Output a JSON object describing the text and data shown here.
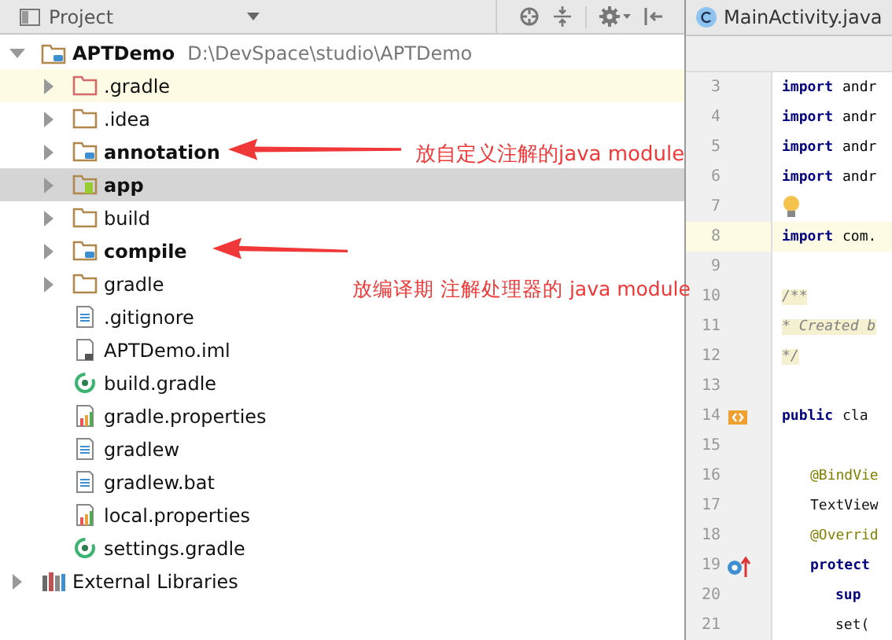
{
  "panel": {
    "title": "Project"
  },
  "tree": [
    {
      "name": "APTDemo",
      "path": "D:\\DevSpace\\studio\\APTDemo",
      "kind": "module",
      "bold": true,
      "expanded": true,
      "selected": false,
      "children": [
        {
          "name": ".gradle",
          "kind": "excluded-folder",
          "bold": false,
          "expanded": false,
          "selected": false,
          "highlighted": true
        },
        {
          "name": ".idea",
          "kind": "folder",
          "bold": false,
          "expanded": false,
          "selected": false,
          "highlighted": false
        },
        {
          "name": "annotation",
          "kind": "module",
          "bold": true,
          "expanded": false,
          "selected": false,
          "highlighted": false
        },
        {
          "name": "app",
          "kind": "android-module",
          "bold": true,
          "expanded": false,
          "selected": true,
          "highlighted": false
        },
        {
          "name": "build",
          "kind": "folder",
          "bold": false,
          "expanded": false,
          "selected": false,
          "highlighted": false
        },
        {
          "name": "compile",
          "kind": "module",
          "bold": true,
          "expanded": false,
          "selected": false,
          "highlighted": false
        },
        {
          "name": "gradle",
          "kind": "folder",
          "bold": false,
          "expanded": false,
          "selected": false,
          "highlighted": false
        },
        {
          "name": ".gitignore",
          "kind": "text-file",
          "bold": false,
          "selected": false,
          "highlighted": false
        },
        {
          "name": "APTDemo.iml",
          "kind": "iml-file",
          "bold": false,
          "selected": false,
          "highlighted": false
        },
        {
          "name": "build.gradle",
          "kind": "gradle-file",
          "bold": false,
          "selected": false,
          "highlighted": false
        },
        {
          "name": "gradle.properties",
          "kind": "properties-file",
          "bold": false,
          "selected": false,
          "highlighted": false
        },
        {
          "name": "gradlew",
          "kind": "text-file",
          "bold": false,
          "selected": false,
          "highlighted": false
        },
        {
          "name": "gradlew.bat",
          "kind": "text-file",
          "bold": false,
          "selected": false,
          "highlighted": false
        },
        {
          "name": "local.properties",
          "kind": "properties-file",
          "bold": false,
          "selected": false,
          "highlighted": false
        },
        {
          "name": "settings.gradle",
          "kind": "gradle-file",
          "bold": false,
          "selected": false,
          "highlighted": false
        }
      ]
    },
    {
      "name": "External Libraries",
      "kind": "libraries",
      "bold": false,
      "expanded": false,
      "selected": false
    }
  ],
  "editor": {
    "tab": "MainActivity.java",
    "lines": [
      {
        "n": "3",
        "kind": "import",
        "kw": "import",
        "text": "andr",
        "current": false
      },
      {
        "n": "4",
        "kind": "import",
        "kw": "import",
        "text": "andr",
        "current": false
      },
      {
        "n": "5",
        "kind": "import",
        "kw": "import",
        "text": "andr",
        "current": false
      },
      {
        "n": "6",
        "kind": "import",
        "kw": "import",
        "text": "andr",
        "current": false
      },
      {
        "n": "7",
        "kind": "hint",
        "current": false
      },
      {
        "n": "8",
        "kind": "import",
        "kw": "import",
        "text": "com.",
        "current": true
      },
      {
        "n": "9",
        "kind": "blank",
        "current": false
      },
      {
        "n": "10",
        "kind": "comment",
        "text": "/**",
        "current": false
      },
      {
        "n": "11",
        "kind": "comment",
        "text": " * Created b",
        "current": false
      },
      {
        "n": "12",
        "kind": "comment",
        "text": " */",
        "current": false
      },
      {
        "n": "13",
        "kind": "blank",
        "current": false
      },
      {
        "n": "14",
        "kind": "class",
        "kw": "public",
        "text": "cla",
        "current": false
      },
      {
        "n": "15",
        "kind": "blank",
        "current": false
      },
      {
        "n": "16",
        "kind": "annotation",
        "text": "@BindVie",
        "current": false
      },
      {
        "n": "17",
        "kind": "field",
        "text": "TextView",
        "current": false
      },
      {
        "n": "18",
        "kind": "annotation",
        "text": "@Overrid",
        "current": false
      },
      {
        "n": "19",
        "kind": "method",
        "kw": "protect",
        "current": false
      },
      {
        "n": "20",
        "kind": "statement",
        "kw": "sup",
        "current": false
      },
      {
        "n": "21",
        "kind": "call",
        "text": "set(",
        "current": false
      }
    ]
  },
  "annotations": [
    {
      "text": "放自定义注解的java module"
    },
    {
      "text": "放编译期 注解处理器的 java module"
    }
  ]
}
